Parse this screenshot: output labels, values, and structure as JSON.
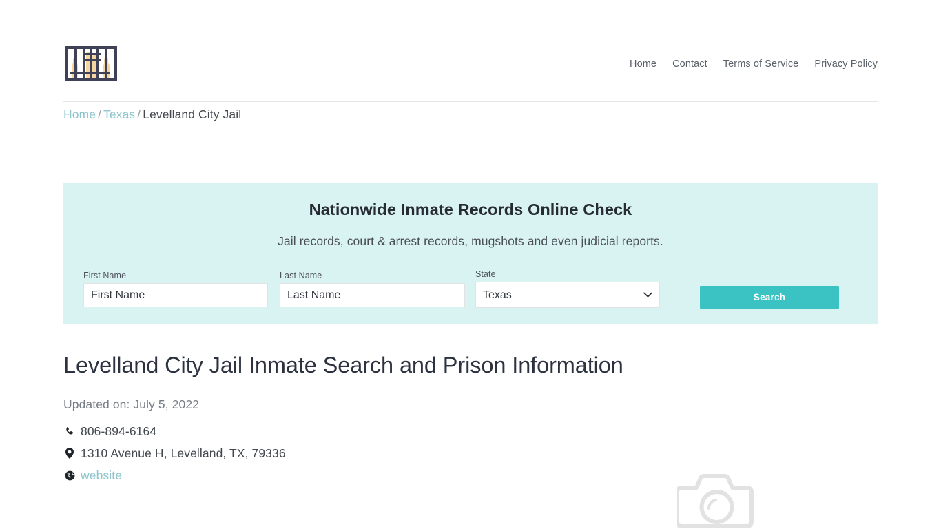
{
  "header": {
    "logo_name": "jail-bars-logo",
    "nav": [
      {
        "label": "Home"
      },
      {
        "label": "Contact"
      },
      {
        "label": "Terms of Service"
      },
      {
        "label": "Privacy Policy"
      }
    ]
  },
  "breadcrumb": {
    "home": "Home",
    "state": "Texas",
    "current": "Levelland City Jail",
    "separator": "/"
  },
  "search_panel": {
    "title": "Nationwide Inmate Records Online Check",
    "subtitle": "Jail records, court & arrest records, mugshots and even judicial reports.",
    "first_name": {
      "label": "First Name",
      "placeholder": "First Name",
      "value": ""
    },
    "last_name": {
      "label": "Last Name",
      "placeholder": "Last Name",
      "value": ""
    },
    "state": {
      "label": "State",
      "selected": "Texas",
      "options": [
        "Texas"
      ]
    },
    "search_button": "Search",
    "background_color": "#d9f2f2",
    "button_color": "#3bc3c3"
  },
  "main": {
    "title": "Levelland City Jail Inmate Search and Prison Information",
    "updated": "Updated on: July 5, 2022",
    "details": [
      {
        "icon": "phone-icon",
        "text": "806-894-6164"
      },
      {
        "icon": "map-pin-icon",
        "text": "1310 Avenue H, Levelland, TX, 79336"
      },
      {
        "icon": "globe-icon",
        "text": "website",
        "is_link": true
      }
    ],
    "photo_placeholder_icon": "camera-icon",
    "link_color": "#8ec5cd"
  }
}
